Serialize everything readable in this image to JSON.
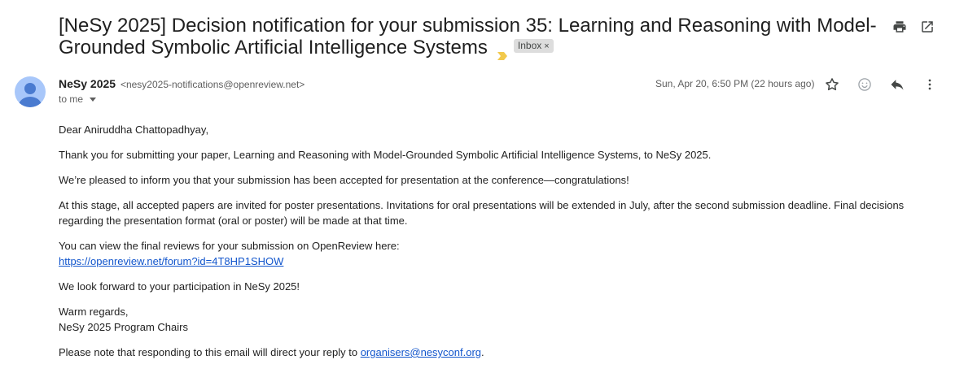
{
  "email": {
    "subject": "[NeSy 2025] Decision notification for your submission 35: Learning and Reasoning with Model-Grounded Symbolic Artificial Intelligence Systems",
    "label": "Inbox",
    "label_remove": "×",
    "sender_name": "NeSy 2025",
    "sender_address": "<nesy2025-notifications@openreview.net>",
    "recipient": "to me",
    "date": "Sun, Apr 20, 6:50 PM (22 hours ago)",
    "body": {
      "greeting": "Dear Aniruddha Chattopadhyay,",
      "p1": "Thank you for submitting your paper, Learning and Reasoning with Model-Grounded Symbolic Artificial Intelligence Systems, to NeSy 2025.",
      "p2": "We’re pleased to inform you that your submission has been accepted for presentation at the conference—congratulations!",
      "p3": "At this stage, all accepted papers are invited for poster presentations. Invitations for oral presentations will be extended in July, after the second submission deadline. Final decisions regarding the presentation format (oral or poster) will be made at that time.",
      "p4_text": "You can view the final reviews for your submission on OpenReview here:",
      "p4_link": "https://openreview.net/forum?id=4T8HP1SHOW",
      "p5": "We look forward to your participation in NeSy 2025!",
      "closing": "Warm regards,",
      "signature": "NeSy 2025 Program Chairs",
      "note_text": "Please note that responding to this email will direct your reply to ",
      "note_link": "organisers@nesyconf.org",
      "note_end": "."
    }
  },
  "icons": {
    "print": "print-icon",
    "open_new_window": "open-in-new-window-icon",
    "star": "star-icon",
    "emoji": "emoji-reaction-icon",
    "reply": "reply-icon",
    "more": "more-vertical-icon",
    "importance": "importance-marker-icon"
  },
  "colors": {
    "link": "#1155cc",
    "importance_marker": "#f2c94c",
    "avatar": "#a8c7fa",
    "avatar_figure": "#4a7bd0"
  }
}
